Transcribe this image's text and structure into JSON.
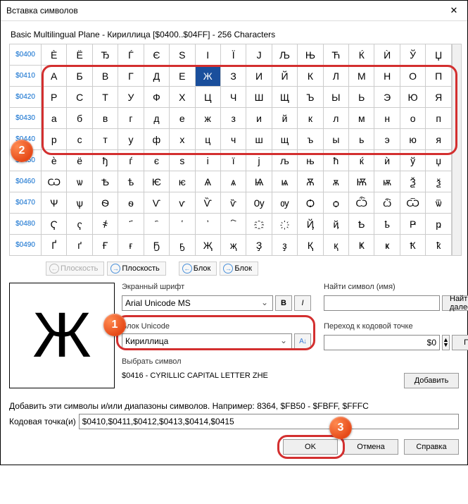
{
  "title": "Вставка символов",
  "header": "Basic Multilingual Plane - Кириллица [$0400..$04FF] - 256 Characters",
  "rowHeaders": [
    "$0400",
    "$0410",
    "$0420",
    "$0430",
    "$0440",
    "$0450",
    "$0460",
    "$0470",
    "$0480",
    "$0490"
  ],
  "rows": [
    [
      "Ѐ",
      "Ё",
      "Ђ",
      "Ѓ",
      "Є",
      "Ѕ",
      "І",
      "Ї",
      "Ј",
      "Љ",
      "Њ",
      "Ћ",
      "Ќ",
      "Ѝ",
      "Ў",
      "Џ"
    ],
    [
      "А",
      "Б",
      "В",
      "Г",
      "Д",
      "Е",
      "Ж",
      "З",
      "И",
      "Й",
      "К",
      "Л",
      "М",
      "Н",
      "О",
      "П"
    ],
    [
      "Р",
      "С",
      "Т",
      "У",
      "Ф",
      "Х",
      "Ц",
      "Ч",
      "Ш",
      "Щ",
      "Ъ",
      "Ы",
      "Ь",
      "Э",
      "Ю",
      "Я"
    ],
    [
      "а",
      "б",
      "в",
      "г",
      "д",
      "е",
      "ж",
      "з",
      "и",
      "й",
      "к",
      "л",
      "м",
      "н",
      "о",
      "п"
    ],
    [
      "р",
      "с",
      "т",
      "у",
      "ф",
      "х",
      "ц",
      "ч",
      "ш",
      "щ",
      "ъ",
      "ы",
      "ь",
      "э",
      "ю",
      "я"
    ],
    [
      "ѐ",
      "ё",
      "ђ",
      "ѓ",
      "є",
      "ѕ",
      "і",
      "ї",
      "ј",
      "љ",
      "њ",
      "ћ",
      "ќ",
      "ѝ",
      "ў",
      "џ"
    ],
    [
      "Ѡ",
      "ѡ",
      "Ѣ",
      "ѣ",
      "Ѥ",
      "ѥ",
      "Ѧ",
      "ѧ",
      "Ѩ",
      "ѩ",
      "Ѫ",
      "ѫ",
      "Ѭ",
      "ѭ",
      "Ѯ",
      "ѯ"
    ],
    [
      "Ѱ",
      "ѱ",
      "Ѳ",
      "ѳ",
      "Ѵ",
      "ѵ",
      "Ѷ",
      "ѷ",
      "Ѹ",
      "ѹ",
      "Ѻ",
      "ѻ",
      "Ѽ",
      "ѽ",
      "Ѿ",
      "ѿ"
    ],
    [
      "Ҁ",
      "ҁ",
      "҂",
      "҃",
      "҄",
      "҅",
      "҆",
      "҇",
      "҈",
      "҉",
      "Ҋ",
      "ҋ",
      "Ҍ",
      "ҍ",
      "Ҏ",
      "ҏ"
    ],
    [
      "Ґ",
      "ґ",
      "Ғ",
      "ғ",
      "Ҕ",
      "ҕ",
      "Җ",
      "җ",
      "Ҙ",
      "ҙ",
      "Қ",
      "қ",
      "Ҝ",
      "ҝ",
      "Ҟ",
      "ҟ"
    ]
  ],
  "selected": {
    "row": 1,
    "col": 6
  },
  "nav": {
    "plane_prev": "Плоскость",
    "plane_next": "Плоскость",
    "block_prev": "Блок",
    "block_next": "Блок"
  },
  "preview_char": "Ж",
  "font": {
    "label": "Экранный шрифт",
    "value": "Arial Unicode MS",
    "bold": "B",
    "italic": "I"
  },
  "block": {
    "label": "Блок Unicode",
    "value": "Кириллица"
  },
  "sel_label": "Выбрать символ",
  "sel_desc": "$0416 - CYRILLIC CAPITAL LETTER ZHE",
  "find": {
    "label": "Найти символ (имя)",
    "btn": "Найти далее"
  },
  "goto": {
    "label": "Переход к кодовой точке",
    "value": "$0",
    "btn": "Переход"
  },
  "add_btn": "Добавить",
  "bottom_hint": "Добавить эти символы и/или диапазоны символов. Например: 8364, $FB50 - $FBFF, $FFFC",
  "cp_label": "Кодовая точка(и)",
  "cp_value": "$0410,$0411,$0412,$0413,$0414,$0415",
  "actions": {
    "ok": "OK",
    "cancel": "Отмена",
    "help": "Справка"
  },
  "badges": {
    "b1": "1",
    "b2": "2",
    "b3": "3"
  }
}
